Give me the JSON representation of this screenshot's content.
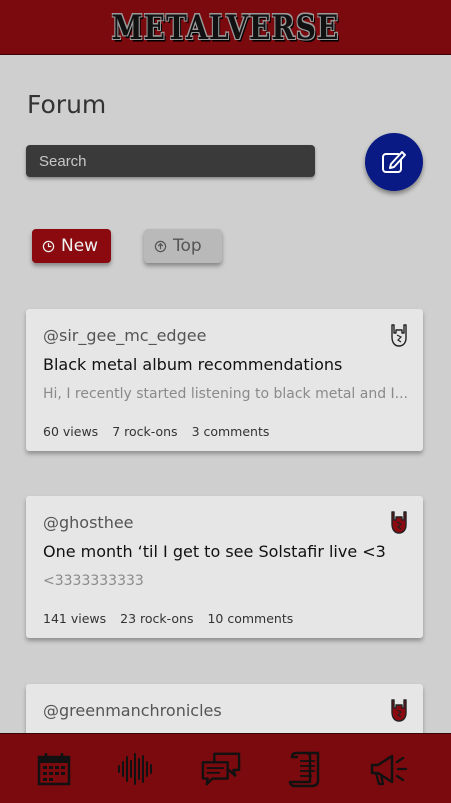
{
  "app": {
    "logo": "METALVERSE"
  },
  "page": {
    "title": "Forum"
  },
  "search": {
    "placeholder": "Search"
  },
  "filters": [
    {
      "label": "New",
      "icon": "clock-icon",
      "active": true
    },
    {
      "label": "Top",
      "icon": "arrow-up-circle-icon",
      "active": false
    }
  ],
  "posts": [
    {
      "user": "@sir_gee_mc_edgee",
      "title": "Black metal album recommendations",
      "excerpt": "Hi, I recently started listening to black metal and I...",
      "views": "60 views",
      "rockons": "7 rock-ons",
      "comments": "3 comments",
      "rocked": false
    },
    {
      "user": "@ghosthee",
      "title": "One month ‘til I get to see Solstafir live <3",
      "excerpt": "<3333333333",
      "views": "141 views",
      "rockons": "23 rock-ons",
      "comments": "10 comments",
      "rocked": true
    },
    {
      "user": "@greenmanchronicles",
      "rocked": true
    }
  ],
  "nav": [
    "calendar-icon",
    "soundwave-icon",
    "chat-bubbles-icon",
    "scroll-icon",
    "megaphone-icon"
  ],
  "colors": {
    "brand": "#7b0a0e",
    "accent": "#0a1a84",
    "background": "#cfcfcf",
    "card": "#e6e6e6"
  }
}
